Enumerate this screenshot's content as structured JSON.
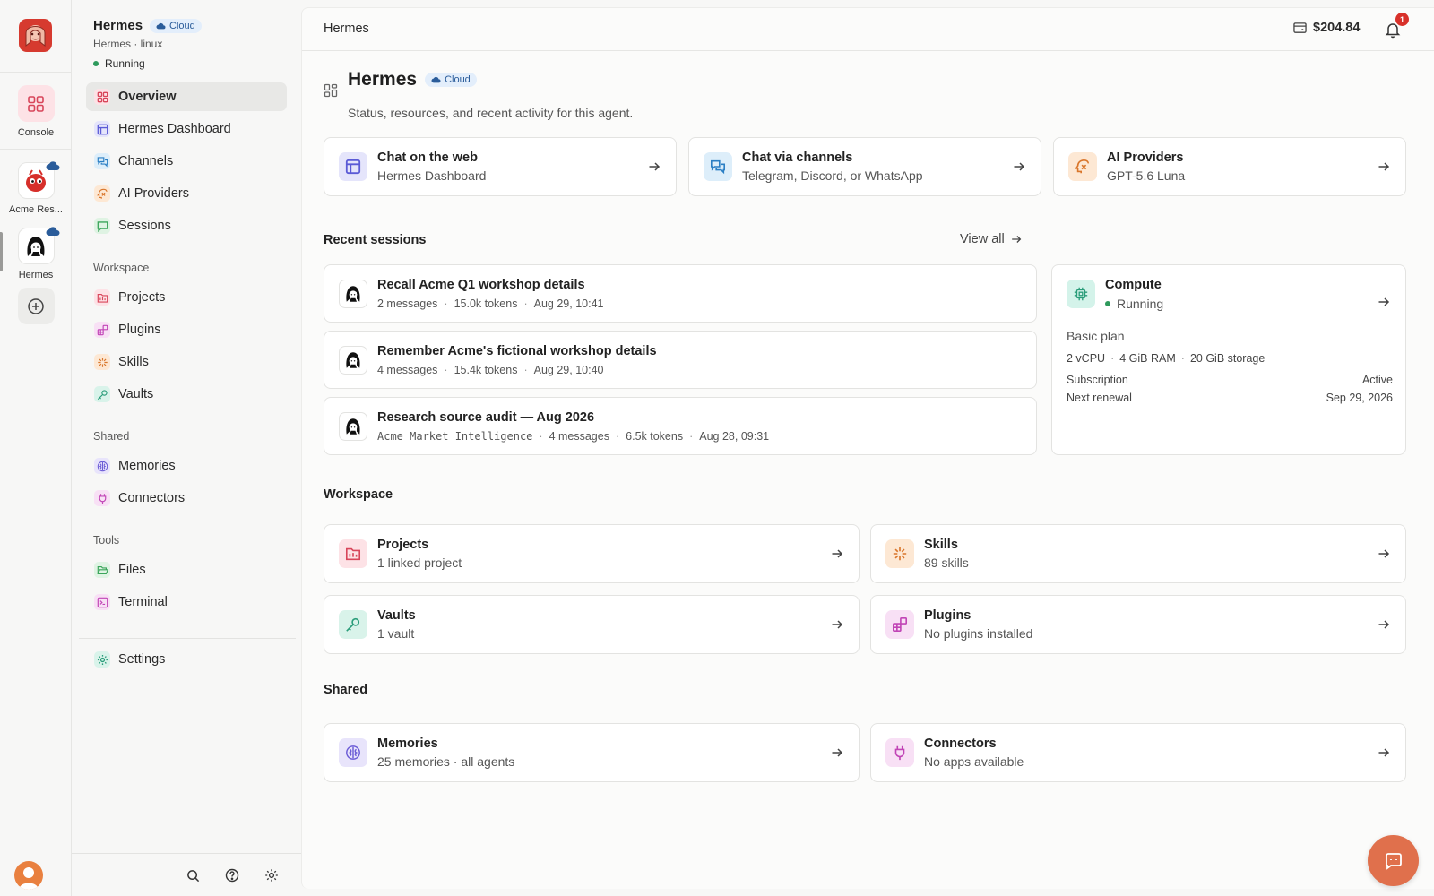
{
  "rail": {
    "items": [
      {
        "label": "Console",
        "icon": "grid-icon"
      },
      {
        "label": "Acme Res...",
        "icon": "red-mascot-avatar"
      },
      {
        "label": "Hermes",
        "icon": "hermes-avatar"
      }
    ],
    "add_icon": "plus-circle-icon"
  },
  "sidebar": {
    "agent_name": "Hermes",
    "agent_badge": "Cloud",
    "agent_sub": "Hermes · linux",
    "agent_status": "Running",
    "nav": [
      {
        "label": "Overview",
        "icon": "grid-icon",
        "color": "#d8455a",
        "bg": "#fde2e6"
      },
      {
        "label": "Hermes Dashboard",
        "icon": "layout-icon",
        "color": "#5b5bd6",
        "bg": "#e5e5fb"
      },
      {
        "label": "Channels",
        "icon": "chat-bubbles-icon",
        "color": "#2b7fc4",
        "bg": "#ddeefa"
      },
      {
        "label": "AI Providers",
        "icon": "sparkle-brain-icon",
        "color": "#d9762b",
        "bg": "#fde8d4"
      },
      {
        "label": "Sessions",
        "icon": "message-square-icon",
        "color": "#3aa55a",
        "bg": "#dff3e3"
      }
    ],
    "workspace_label": "Workspace",
    "workspace": [
      {
        "label": "Projects",
        "icon": "folder-icon",
        "color": "#d8455a",
        "bg": "#fde2e6"
      },
      {
        "label": "Plugins",
        "icon": "blocks-icon",
        "color": "#c144b6",
        "bg": "#f8e0f5"
      },
      {
        "label": "Skills",
        "icon": "sparkles-icon",
        "color": "#d9762b",
        "bg": "#fde8d4"
      },
      {
        "label": "Vaults",
        "icon": "key-icon",
        "color": "#2a9d7a",
        "bg": "#d9f3ea"
      }
    ],
    "shared_label": "Shared",
    "shared": [
      {
        "label": "Memories",
        "icon": "brain-icon",
        "color": "#6b5bd6",
        "bg": "#e8e4fb"
      },
      {
        "label": "Connectors",
        "icon": "plug-icon",
        "color": "#c144b6",
        "bg": "#f8e0f5"
      }
    ],
    "tools_label": "Tools",
    "tools": [
      {
        "label": "Files",
        "icon": "folder-open-icon",
        "color": "#3aa55a",
        "bg": "#dff3e3"
      },
      {
        "label": "Terminal",
        "icon": "terminal-icon",
        "color": "#c144b6",
        "bg": "#f8e0f5"
      }
    ],
    "settings_label": "Settings"
  },
  "topbar": {
    "breadcrumb": "Hermes",
    "credit": "$204.84",
    "notification_count": "1"
  },
  "header": {
    "title": "Hermes",
    "badge": "Cloud",
    "description": "Status, resources, and recent activity for this agent."
  },
  "quick_links": [
    {
      "title": "Chat on the web",
      "subtitle": "Hermes Dashboard",
      "icon": "layout-icon",
      "color": "#5b5bd6",
      "bg": "#e5e5fb"
    },
    {
      "title": "Chat via channels",
      "subtitle": "Telegram, Discord, or WhatsApp",
      "icon": "chat-bubbles-icon",
      "color": "#2b7fc4",
      "bg": "#ddeefa"
    },
    {
      "title": "AI Providers",
      "subtitle": "GPT-5.6 Luna",
      "icon": "sparkle-brain-icon",
      "color": "#d9762b",
      "bg": "#fde8d4"
    }
  ],
  "recent_sessions": {
    "title": "Recent sessions",
    "view_all": "View all",
    "items": [
      {
        "title": "Recall Acme Q1 workshop details",
        "project": "",
        "messages": "2 messages",
        "tokens": "15.0k tokens",
        "time": "Aug 29, 10:41"
      },
      {
        "title": "Remember Acme's fictional workshop details",
        "project": "",
        "messages": "4 messages",
        "tokens": "15.4k tokens",
        "time": "Aug 29, 10:40"
      },
      {
        "title": "Research source audit — Aug 2026",
        "project": "Acme Market Intelligence",
        "messages": "4 messages",
        "tokens": "6.5k tokens",
        "time": "Aug 28, 09:31"
      }
    ]
  },
  "compute": {
    "title": "Compute",
    "status": "Running",
    "plan": "Basic plan",
    "cpu": "2 vCPU",
    "ram": "4 GiB RAM",
    "storage": "20 GiB storage",
    "subscription_label": "Subscription",
    "subscription_value": "Active",
    "renewal_label": "Next renewal",
    "renewal_value": "Sep 29, 2026"
  },
  "workspace": {
    "title": "Workspace",
    "items": [
      {
        "title": "Projects",
        "subtitle": "1 linked project",
        "icon": "folder-icon",
        "color": "#d8455a",
        "bg": "#fde2e6"
      },
      {
        "title": "Skills",
        "subtitle": "89 skills",
        "icon": "sparkles-icon",
        "color": "#d9762b",
        "bg": "#fde8d4"
      },
      {
        "title": "Vaults",
        "subtitle": "1 vault",
        "icon": "key-icon",
        "color": "#2a9d7a",
        "bg": "#d9f3ea"
      },
      {
        "title": "Plugins",
        "subtitle": "No plugins installed",
        "icon": "blocks-icon",
        "color": "#c144b6",
        "bg": "#f8e0f5"
      }
    ]
  },
  "shared": {
    "title": "Shared",
    "items": [
      {
        "title": "Memories",
        "subtitle": "25 memories · all agents",
        "icon": "brain-icon",
        "color": "#6b5bd6",
        "bg": "#e8e4fb"
      },
      {
        "title": "Connectors",
        "subtitle": "No apps available",
        "icon": "plug-icon",
        "color": "#c144b6",
        "bg": "#f8e0f5"
      }
    ]
  }
}
